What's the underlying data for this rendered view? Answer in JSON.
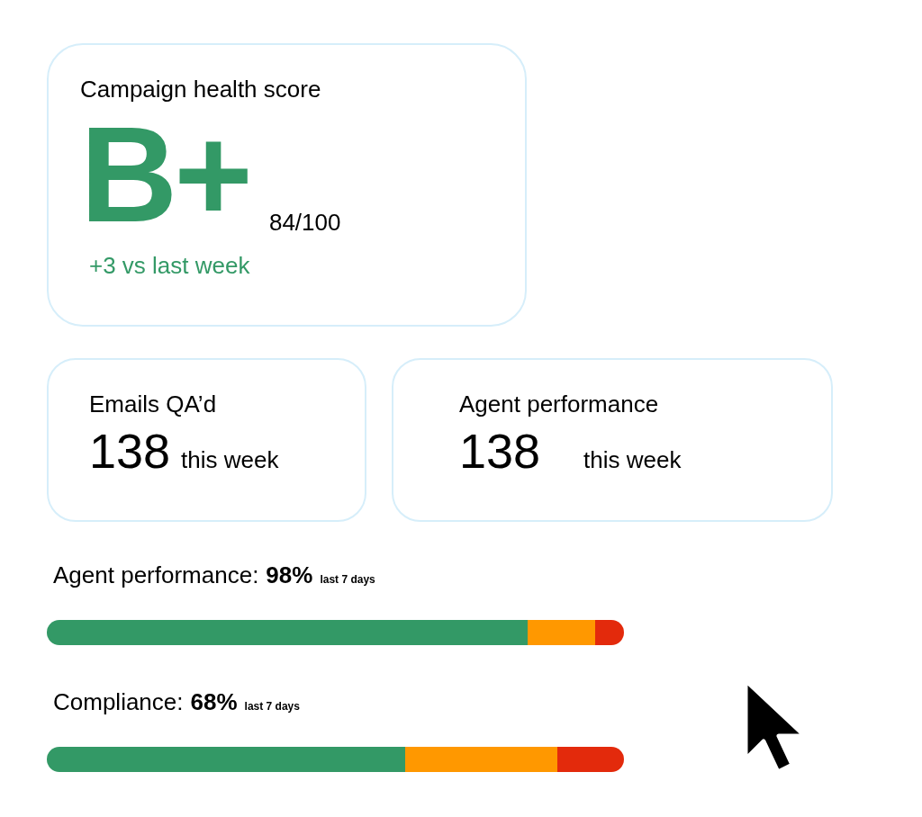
{
  "health_card": {
    "title": "Campaign health score",
    "grade": "B+",
    "score": "84/100",
    "change": "+3 vs last week"
  },
  "stat_cards": [
    {
      "title": "Emails QA’d",
      "value": "138",
      "period": "this week"
    },
    {
      "title": "Agent performance",
      "value": "138",
      "period": "this week"
    }
  ],
  "meters": [
    {
      "label": "Agent performance:",
      "value": "98%",
      "period": "last 7 days",
      "segments": [
        {
          "color": "#339966"
        },
        {
          "color": "#ff9800"
        },
        {
          "color": "#e32a0c"
        }
      ]
    },
    {
      "label": "Compliance:",
      "value": "68%",
      "period": "last 7 days",
      "segments": [
        {
          "color": "#339966"
        },
        {
          "color": "#ff9800"
        },
        {
          "color": "#e32a0c"
        }
      ]
    }
  ]
}
